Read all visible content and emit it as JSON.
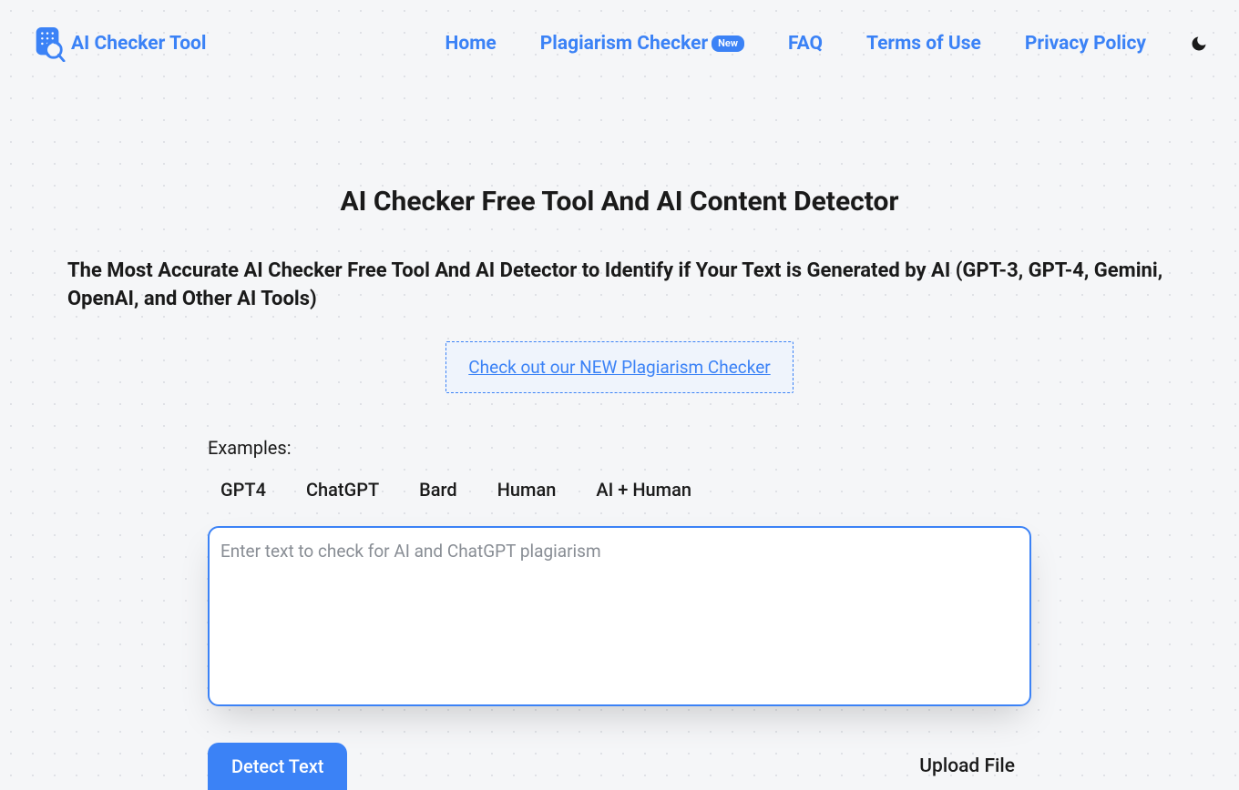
{
  "header": {
    "logo_text": "AI Checker Tool",
    "nav": {
      "home": "Home",
      "plagiarism": "Plagiarism Checker",
      "plagiarism_badge": "New",
      "faq": "FAQ",
      "terms": "Terms of Use",
      "privacy": "Privacy Policy"
    }
  },
  "main": {
    "title": "AI Checker Free Tool And AI Content Detector",
    "subtitle": "The Most Accurate AI Checker Free Tool And AI Detector to Identify if Your Text is Generated by AI (GPT-3, GPT-4, Gemini, OpenAI, and Other AI Tools)",
    "callout": "Check out our NEW Plagiarism Checker",
    "examples_label": "Examples:",
    "examples": {
      "gpt4": "GPT4",
      "chatgpt": "ChatGPT",
      "bard": "Bard",
      "human": "Human",
      "ai_human": "AI + Human"
    },
    "textarea_placeholder": "Enter text to check for AI and ChatGPT plagiarism",
    "detect_button": "Detect Text",
    "upload_button": "Upload File"
  }
}
